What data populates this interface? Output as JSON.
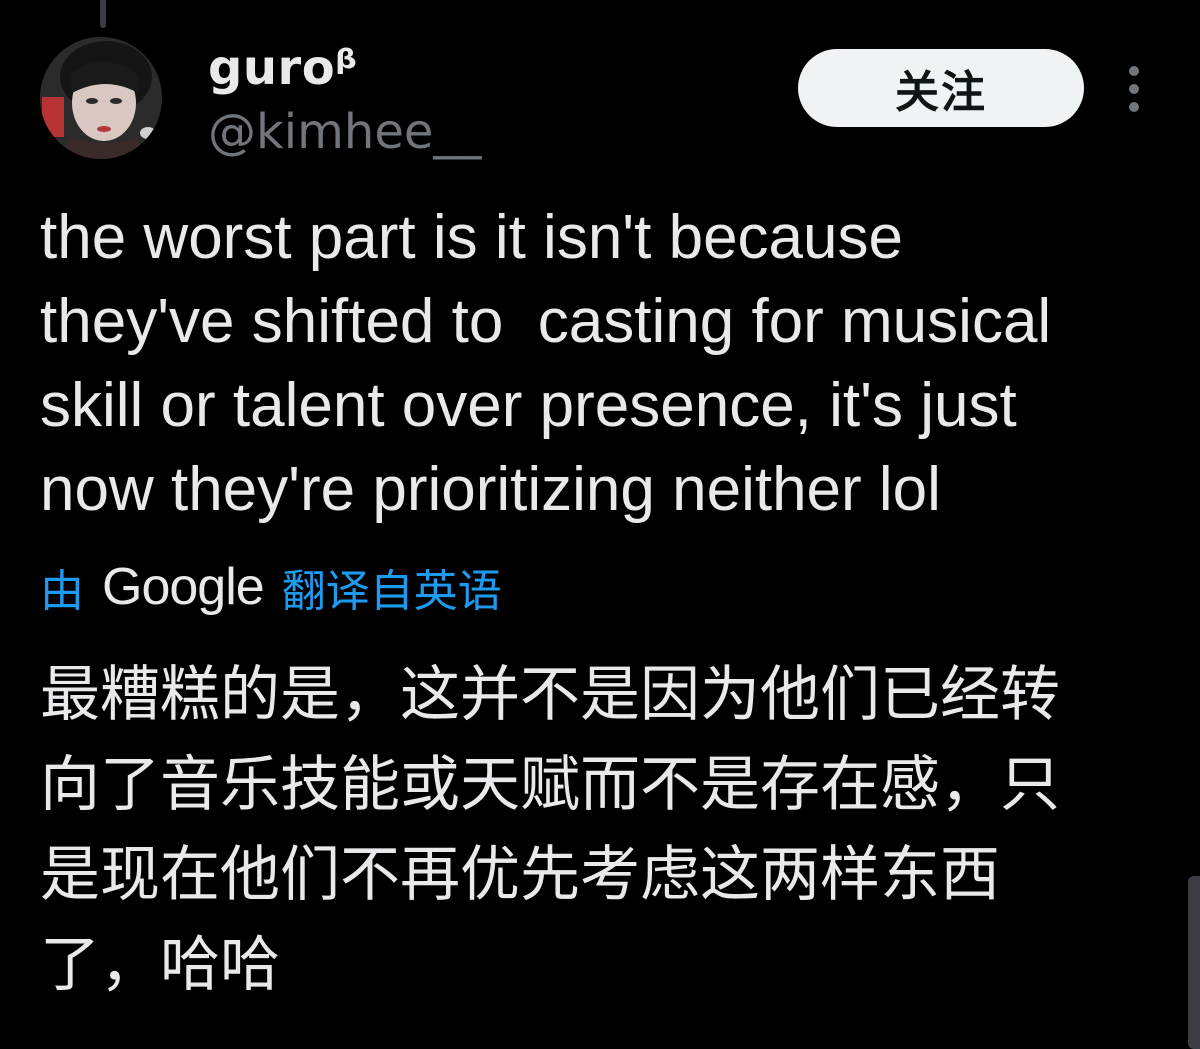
{
  "author": {
    "display_name": "guroᵝ",
    "handle": "@kimhee__"
  },
  "follow_button": {
    "label": "关注"
  },
  "more_button": {
    "icon": "more-vertical-icon"
  },
  "tweet": {
    "text_lines": [
      "the worst part is it isn't because",
      "they've shifted to  casting for musical",
      "skill or talent over presence, it's just",
      "now they're prioritizing neither lol"
    ]
  },
  "translation": {
    "prefix": "由",
    "provider": "Google",
    "suffix": "翻译自英语",
    "text_lines": [
      "最糟糕的是，这并不是因为他们已经转",
      "向了音乐技能或天赋而不是存在感，只",
      "是现在他们不再优先考虑这两样东西",
      "了，哈哈"
    ]
  },
  "colors": {
    "background": "#000000",
    "text_primary": "#e7e9ea",
    "text_secondary": "#71767b",
    "link": "#1d9bf0",
    "follow_button_bg": "#eff3f4"
  }
}
